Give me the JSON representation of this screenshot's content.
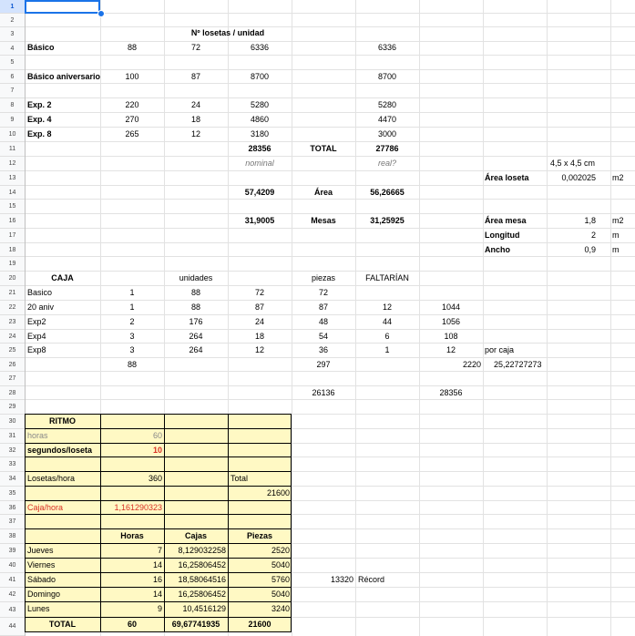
{
  "rows": [
    "1",
    "2",
    "3",
    "4",
    "5",
    "6",
    "7",
    "8",
    "9",
    "10",
    "11",
    "12",
    "13",
    "14",
    "15",
    "16",
    "17",
    "18",
    "19",
    "20",
    "21",
    "22",
    "23",
    "24",
    "25",
    "26",
    "27",
    "28",
    "29",
    "30",
    "31",
    "32",
    "33",
    "34",
    "35",
    "36",
    "37",
    "38",
    "39",
    "40",
    "41",
    "42",
    "43",
    "44"
  ],
  "top": {
    "header": "Nº losetas / unidad",
    "basico": {
      "label": "Básico",
      "a": "88",
      "b": "72",
      "c": "6336",
      "d": "6336"
    },
    "aniv": {
      "label": "Básico aniversario",
      "a": "100",
      "b": "87",
      "c": "8700",
      "d": "8700"
    },
    "exp2": {
      "label": "Exp. 2",
      "a": "220",
      "b": "24",
      "c": "5280",
      "d": "5280"
    },
    "exp4": {
      "label": "Exp. 4",
      "a": "270",
      "b": "18",
      "c": "4860",
      "d": "4470"
    },
    "exp8": {
      "label": "Exp. 8",
      "a": "265",
      "b": "12",
      "c": "3180",
      "d": "3000"
    },
    "sum": {
      "c": "28356",
      "total": "TOTAL",
      "d": "27786"
    },
    "nominal": "nominal",
    "real": "real?",
    "row14": {
      "c": "57,4209",
      "label": "Área",
      "d": "56,26665"
    },
    "row16": {
      "c": "31,9005",
      "label": "Mesas",
      "d": "31,25925"
    },
    "size": "4,5 x 4,5 cm",
    "area_loseta": {
      "label": "Área loseta",
      "value": "0,002025",
      "unit": "m2"
    },
    "area_mesa": {
      "label": "Área mesa",
      "value": "1,8",
      "unit": "m2"
    },
    "longitud": {
      "label": "Longitud",
      "value": "2",
      "unit": "m"
    },
    "ancho": {
      "label": "Ancho",
      "value": "0,9",
      "unit": "m"
    }
  },
  "caja": {
    "headers": {
      "caja": "CAJA",
      "unidades": "unidades",
      "piezas": "piezas",
      "faltarian": "FALTARÍAN"
    },
    "rows": [
      {
        "name": "Basico",
        "n": "1",
        "u": "88",
        "v": "72",
        "p": "72",
        "f": "",
        "g": ""
      },
      {
        "name": "20 aniv",
        "n": "1",
        "u": "88",
        "v": "87",
        "p": "87",
        "f": "12",
        "g": "1044"
      },
      {
        "name": "Exp2",
        "n": "2",
        "u": "176",
        "v": "24",
        "p": "48",
        "f": "44",
        "g": "1056"
      },
      {
        "name": "Exp4",
        "n": "3",
        "u": "264",
        "v": "18",
        "p": "54",
        "f": "6",
        "g": "108"
      },
      {
        "name": "Exp8",
        "n": "3",
        "u": "264",
        "v": "12",
        "p": "36",
        "f": "1",
        "g": "12"
      }
    ],
    "por_caja": "por caja",
    "row26": {
      "n": "88",
      "p": "297",
      "g": "2220",
      "h": "25,22727273"
    },
    "row28": {
      "p": "26136",
      "g": "28356"
    }
  },
  "ritmo": {
    "title": "RITMO",
    "horas_label": "horas",
    "horas_value": "60",
    "seg_label": "segundos/loseta",
    "seg_value": "10",
    "losetas_label": "Losetas/hora",
    "losetas_value": "360",
    "total_label": "Total",
    "total_value": "21600",
    "caja_label": "Caja/hora",
    "caja_value": "1,161290323",
    "table_headers": {
      "horas": "Horas",
      "cajas": "Cajas",
      "piezas": "Piezas"
    },
    "days": [
      {
        "day": "Jueves",
        "horas": "7",
        "cajas": "8,129032258",
        "piezas": "2520"
      },
      {
        "day": "Viernes",
        "horas": "14",
        "cajas": "16,25806452",
        "piezas": "5040"
      },
      {
        "day": "Sábado",
        "horas": "16",
        "cajas": "18,58064516",
        "piezas": "5760"
      },
      {
        "day": "Domingo",
        "horas": "14",
        "cajas": "16,25806452",
        "piezas": "5040"
      },
      {
        "day": "Lunes",
        "horas": "9",
        "cajas": "10,4516129",
        "piezas": "3240"
      }
    ],
    "total_row": {
      "label": "TOTAL",
      "horas": "60",
      "cajas": "69,67741935",
      "piezas": "21600"
    },
    "record_value": "13320",
    "record_label": "Récord"
  }
}
